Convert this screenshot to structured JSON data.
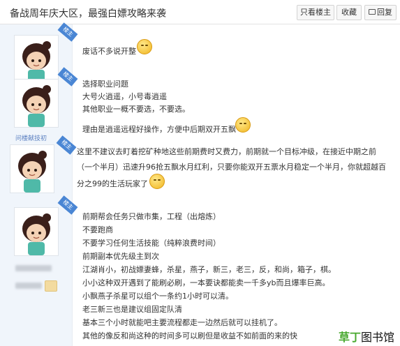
{
  "header": {
    "title": "备战周年庆大区，最强白嫖攻略来袭",
    "buttons": {
      "only_op": "只看楼主",
      "favorite": "收藏",
      "reply": "回复"
    },
    "reply_icon": "comment-icon"
  },
  "posts": {
    "badge": "楼主",
    "p1": {
      "l1": "废话不多说开整"
    },
    "p2": {
      "username": "问楼献技初",
      "l1": "选择职业问题",
      "l2": "大号火逍遥，小号毒逍遥",
      "l3": "其他职业一概不要选，不要选。",
      "l4": "理由是逍遥远程好操作，方便中后期双开五飘"
    },
    "p3": {
      "l1": "这里不建议去盯着挖矿种地这些前期费时又费力，前期就一个目标冲级，在接近中期之前",
      "l2": "（一个半月）迅速升96抢五飘水月红利，只要你能双开五票水月稳定一个半月，你就超越百",
      "l3": "分之99的生活玩家了"
    },
    "p4": {
      "l1": "前期帮会任务只做市集，工程（出熔炼）",
      "l2": "不要跑商",
      "l3": "不要学习任何生活技能（纯粹浪费时间）",
      "l4": "前期副本优先级主到次",
      "l5": "江湖肖小，初战嫖妻蜂，杀星，燕子，新三，老三，反，和尚，箱子，棋。",
      "l6": "小小这种双开遇到了能刷必刷，一本要诀都能卖一千多yb而且爆率巨高。",
      "l7": "小飘燕子杀星可以组个一条约1小时可以清。",
      "l8": "老三新三也是建议组固定队清",
      "l9": "基本三个小时就能吧主要流程都走一边然后就可以挂机了。",
      "l10": "其他的像反和尚这种的时间多可以刷但是收益不如前面的来的快"
    }
  },
  "watermark": {
    "part1": "草",
    "part2": "丁",
    "part3": "图书馆"
  },
  "colors": {
    "sidebar_bg": "#f0f5fb",
    "badge": "#4a86d4",
    "watermark_green": "#48a82e"
  }
}
